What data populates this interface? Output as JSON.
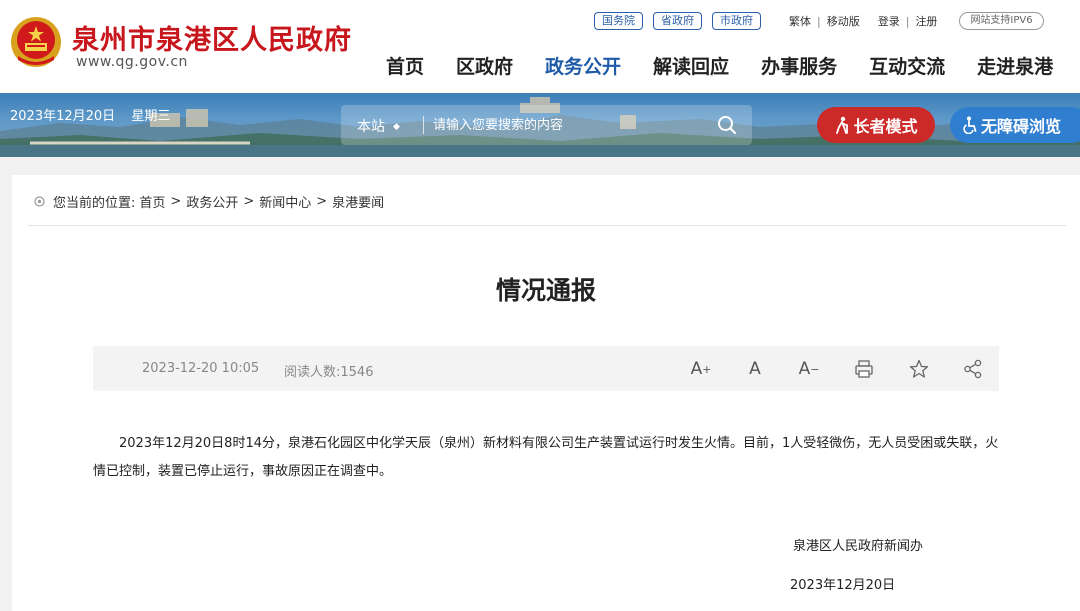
{
  "header": {
    "site_name": "泉州市泉港区人民政府",
    "site_url": "www.qg.gov.cn",
    "top_links": {
      "gov_council": "国务院",
      "province_gov": "省政府",
      "city_gov": "市政府",
      "traditional": "繁体",
      "mobile": "移动版",
      "login": "登录",
      "register": "注册",
      "ipv6": "网站支持IPV6"
    },
    "nav": [
      "首页",
      "区政府",
      "政务公开",
      "解读回应",
      "办事服务",
      "互动交流",
      "走进泉港"
    ],
    "nav_active_index": 2
  },
  "banner": {
    "date": "2023年12月20日",
    "weekday": "星期三",
    "search_scope": "本站",
    "search_placeholder": "请输入您要搜索的内容",
    "elder_mode": "长者模式",
    "accessibility": "无障碍浏览"
  },
  "breadcrumb": {
    "prefix": "您当前的位置:",
    "items": [
      "首页",
      "政务公开",
      "新闻中心",
      "泉港要闻"
    ]
  },
  "article": {
    "title": "情况通报",
    "publish_time": "2023-12-20 10:05",
    "reads": "阅读人数:1546",
    "body": "2023年12月20日8时14分，泉港石化园区中化学天辰（泉州）新材料有限公司生产装置试运行时发生火情。目前，1人受轻微伤，无人员受困或失联，火情已控制，装置已停止运行，事故原因正在调查中。",
    "signature_org": "泉港区人民政府新闻办",
    "signature_date": "2023年12月20日"
  },
  "tools": {
    "font_larger": "A",
    "font_normal": "A",
    "font_smaller": "A"
  },
  "colors": {
    "brand_red": "#c8161d",
    "nav_active": "#1f5ba8",
    "elder_button": "#cc2a29",
    "access_button": "#2f7ed0"
  }
}
